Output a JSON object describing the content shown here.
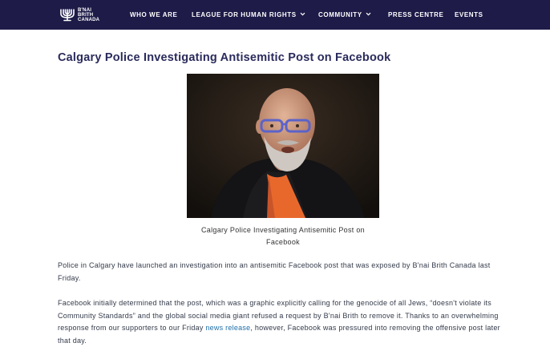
{
  "header": {
    "logo_text_lines": [
      "B'NAI",
      "BRITH",
      "CANADA"
    ],
    "logo_icon": "menorah-icon",
    "nav": [
      {
        "label": "WHO WE ARE",
        "has_dropdown": false
      },
      {
        "label": "LEAGUE FOR HUMAN RIGHTS",
        "has_dropdown": true
      },
      {
        "label": "COMMUNITY",
        "has_dropdown": true
      },
      {
        "label": "PRESS CENTRE",
        "has_dropdown": false
      },
      {
        "label": "EVENTS",
        "has_dropdown": false
      }
    ],
    "dropdown_icon": "chevron-down-icon"
  },
  "article": {
    "title": "Calgary Police Investigating Antisemitic Post on Facebook",
    "image_caption": "Calgary Police Investigating Antisemitic Post on Facebook",
    "paragraph1": "Police in Calgary have launched an investigation into an antisemitic Facebook post that was exposed by B'nai Brith Canada last Friday.",
    "paragraph2_before_link": "Facebook initially determined that the post, which was a graphic explicitly calling for the genocide of all Jews, “doesn't violate its Community Standards” and the global social media giant refused a request by B'nai Brith to remove it. Thanks to an overwhelming response from our supporters to our Friday ",
    "paragraph2_link": "news release",
    "paragraph2_after_link": ", however, Facebook was pressured into removing the offensive post later that day."
  },
  "colors": {
    "navbar_bg": "#1e1b48",
    "title": "#2a2b5c",
    "link": "#1f6fa8",
    "body_text": "#333a4a"
  }
}
